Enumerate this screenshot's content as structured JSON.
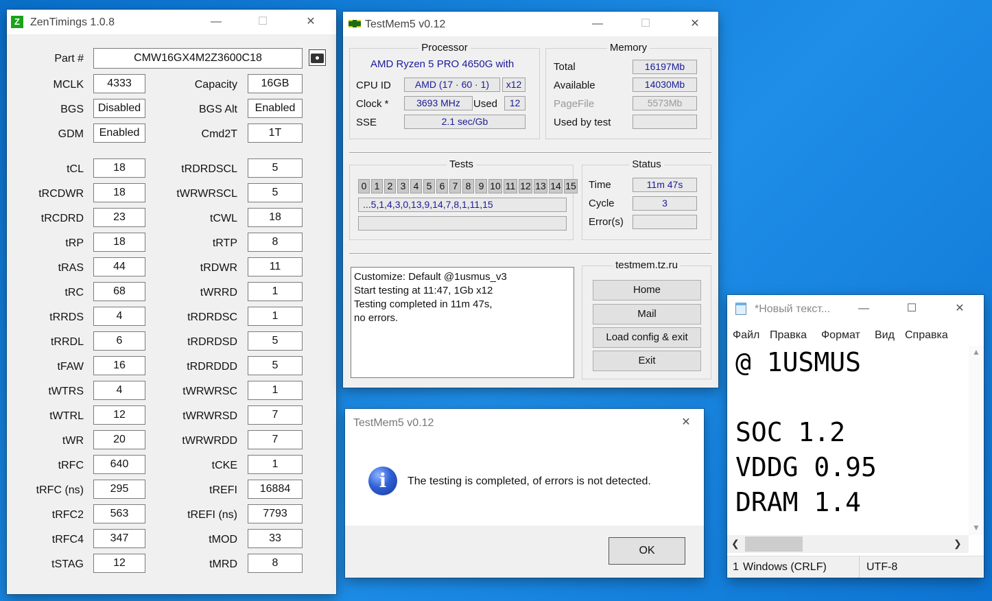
{
  "zentimings": {
    "title": "ZenTimings 1.0.8",
    "part_label": "Part #",
    "part_value": "CMW16GX4M2Z3600C18",
    "left": [
      {
        "label": "MCLK",
        "value": "4333"
      },
      {
        "label": "BGS",
        "value": "Disabled"
      },
      {
        "label": "GDM",
        "value": "Enabled"
      },
      {
        "label": "tCL",
        "value": "18"
      },
      {
        "label": "tRCDWR",
        "value": "18"
      },
      {
        "label": "tRCDRD",
        "value": "23"
      },
      {
        "label": "tRP",
        "value": "18"
      },
      {
        "label": "tRAS",
        "value": "44"
      },
      {
        "label": "tRC",
        "value": "68"
      },
      {
        "label": "tRRDS",
        "value": "4"
      },
      {
        "label": "tRRDL",
        "value": "6"
      },
      {
        "label": "tFAW",
        "value": "16"
      },
      {
        "label": "tWTRS",
        "value": "4"
      },
      {
        "label": "tWTRL",
        "value": "12"
      },
      {
        "label": "tWR",
        "value": "20"
      },
      {
        "label": "tRFC",
        "value": "640"
      },
      {
        "label": "tRFC (ns)",
        "value": "295"
      },
      {
        "label": "tRFC2",
        "value": "563"
      },
      {
        "label": "tRFC4",
        "value": "347"
      },
      {
        "label": "tSTAG",
        "value": "12"
      }
    ],
    "right": [
      {
        "label": "Capacity",
        "value": "16GB"
      },
      {
        "label": "BGS Alt",
        "value": "Enabled"
      },
      {
        "label": "Cmd2T",
        "value": "1T"
      },
      {
        "label": "tRDRDSCL",
        "value": "5"
      },
      {
        "label": "tWRWRSCL",
        "value": "5"
      },
      {
        "label": "tCWL",
        "value": "18"
      },
      {
        "label": "tRTP",
        "value": "8"
      },
      {
        "label": "tRDWR",
        "value": "11"
      },
      {
        "label": "tWRRD",
        "value": "1"
      },
      {
        "label": "tRDRDSC",
        "value": "1"
      },
      {
        "label": "tRDRDSD",
        "value": "5"
      },
      {
        "label": "tRDRDDD",
        "value": "5"
      },
      {
        "label": "tWRWRSC",
        "value": "1"
      },
      {
        "label": "tWRWRSD",
        "value": "7"
      },
      {
        "label": "tWRWRDD",
        "value": "7"
      },
      {
        "label": "tCKE",
        "value": "1"
      },
      {
        "label": "tREFI",
        "value": "16884"
      },
      {
        "label": "tREFI (ns)",
        "value": "7793"
      },
      {
        "label": "tMOD",
        "value": "33"
      },
      {
        "label": "tMRD",
        "value": "8"
      }
    ]
  },
  "testmem": {
    "title": "TestMem5 v0.12",
    "processor": {
      "group": "Processor",
      "name": "AMD Ryzen 5 PRO 4650G with",
      "cpuid_label": "CPU ID",
      "cpuid_value": "AMD  (17 · 60 · 1)",
      "threads": "x12",
      "clock_label": "Clock *",
      "clock_value": "3693 MHz",
      "used_label": "Used",
      "used_value": "12",
      "sse_label": "SSE",
      "sse_value": "2.1 sec/Gb"
    },
    "memory": {
      "group": "Memory",
      "total_label": "Total",
      "total_value": "16197Mb",
      "available_label": "Available",
      "available_value": "14030Mb",
      "pagefile_label": "PageFile",
      "pagefile_value": "5573Mb",
      "usedby_label": "Used by test",
      "usedby_value": ""
    },
    "tests": {
      "group": "Tests",
      "cells": [
        "0",
        "1",
        "2",
        "3",
        "4",
        "5",
        "6",
        "7",
        "8",
        "9",
        "10",
        "11",
        "12",
        "13",
        "14",
        "15"
      ],
      "sequence": "...5,1,4,3,0,13,9,14,7,8,1,11,15",
      "progress": ""
    },
    "status": {
      "group": "Status",
      "time_label": "Time",
      "time_value": "11m 47s",
      "cycle_label": "Cycle",
      "cycle_value": "3",
      "errors_label": "Error(s)",
      "errors_value": ""
    },
    "log": [
      "Customize: Default @1usmus_v3",
      "Start testing at 11:47, 1Gb x12",
      "Testing completed in 11m 47s,",
      "no errors."
    ],
    "site": {
      "group": "testmem.tz.ru",
      "home": "Home",
      "mail": "Mail",
      "load": "Load config & exit",
      "exit": "Exit"
    }
  },
  "dialog": {
    "title": "TestMem5 v0.12",
    "message": "The testing is completed, of errors is not detected.",
    "ok": "OK"
  },
  "notepad": {
    "title": "*Новый текст...",
    "menu": [
      "Файл",
      "Правка",
      "Формат",
      "Вид",
      "Справка"
    ],
    "lines": [
      "@ 1USMUS",
      "",
      "SOC 1.2",
      "VDDG 0.95",
      "DRAM 1.4"
    ],
    "status_position": "1",
    "status_eol": "Windows (CRLF)",
    "status_encoding": "UTF-8"
  }
}
